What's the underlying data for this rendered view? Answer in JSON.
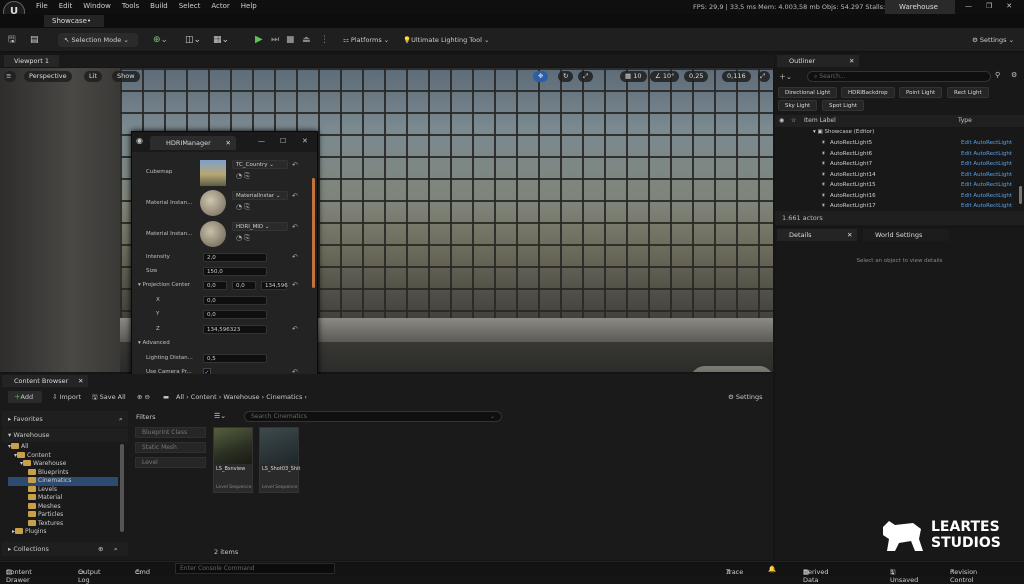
{
  "menubar": {
    "items": [
      "File",
      "Edit",
      "Window",
      "Tools",
      "Build",
      "Select",
      "Actor",
      "Help"
    ],
    "stats": "FPS: 29,9 | 33,5 ms   Mem: 4.003,58 mb   Objs: 54.297   Stalls: 0",
    "project": "Warehouse",
    "logo": "U"
  },
  "level_tab": "Showcase•",
  "toolbar": {
    "selection_mode": "Selection Mode",
    "platforms": "Platforms",
    "lighting_tool": "Ultimate Lighting Tool",
    "settings": "Settings"
  },
  "viewport": {
    "tab": "Viewport 1",
    "perspective": "Perspective",
    "lit": "Lit",
    "show": "Show",
    "grid_snap": "10",
    "rot_snap": "10°",
    "scale_snap": "0,25",
    "cam_speed": "0,116"
  },
  "hdri": {
    "title": "HDRIManager",
    "cubemap_label": "Cubemap",
    "cubemap_value": "TC_Country",
    "mat1_label": "Material Instan...",
    "mat1_value": "MaterialInstar",
    "mat2_label": "Material Instan...",
    "mat2_value": "HDRI_MID",
    "intensity_label": "Intensity",
    "intensity": "2,0",
    "size_label": "Size",
    "size": "150,0",
    "proj_label": "Projection Center",
    "proj_x": "0,0",
    "proj_y": "0,0",
    "proj_z": "134,596",
    "x_label": "X",
    "x": "0,0",
    "y_label": "Y",
    "y": "0,0",
    "z_label": "Z",
    "z": "134,596323",
    "advanced": "Advanced",
    "lighting_label": "Lighting Distan...",
    "lighting": "0,5",
    "camera_label": "Use Camera Pr..."
  },
  "outliner": {
    "tab": "Outliner",
    "search_placeholder": "Search...",
    "chips": [
      "Directional Light",
      "HDRIBackdrop",
      "Point Light",
      "Rect Light",
      "Sky Light",
      "Spot Light"
    ],
    "col_label": "Item Label",
    "col_type": "Type",
    "root": "Showcase (Editor)",
    "rows": [
      {
        "name": "AutoRectLight5",
        "type": "Edit AutoRectLight"
      },
      {
        "name": "AutoRectLight6",
        "type": "Edit AutoRectLight"
      },
      {
        "name": "AutoRectLight7",
        "type": "Edit AutoRectLight"
      },
      {
        "name": "AutoRectLight14",
        "type": "Edit AutoRectLight"
      },
      {
        "name": "AutoRectLight15",
        "type": "Edit AutoRectLight"
      },
      {
        "name": "AutoRectLight16",
        "type": "Edit AutoRectLight"
      },
      {
        "name": "AutoRectLight17",
        "type": "Edit AutoRectLight"
      }
    ],
    "count": "1.661 actors"
  },
  "details": {
    "tab": "Details",
    "world_tab": "World Settings",
    "empty": "Select an object to view details"
  },
  "content_browser": {
    "tab": "Content Browser",
    "add": "Add",
    "import": "Import",
    "save_all": "Save All",
    "path": [
      "All",
      "Content",
      "Warehouse",
      "Cinematics"
    ],
    "settings": "Settings",
    "favorites": "Favorites",
    "warehouse": "Warehouse",
    "tree": [
      "All",
      "Content",
      "Warehouse",
      "Blueprints",
      "Cinematics",
      "Levels",
      "Material",
      "Meshes",
      "Particles",
      "Textures",
      "Plugins"
    ],
    "filters_title": "Filters",
    "filters": [
      "Blueprint Class",
      "Static Mesh",
      "Level"
    ],
    "search_placeholder": "Search Cinematics",
    "assets": [
      {
        "name": "LS_Bsnview",
        "type": "Level Sequence"
      },
      {
        "name": "LS_Shot03_Shit",
        "type": "Level Sequence"
      }
    ],
    "count": "2 items",
    "collections": "Collections"
  },
  "status": {
    "drawer": "Content Drawer",
    "output": "Output Log",
    "cmd": "Cmd",
    "console_placeholder": "Enter Console Command",
    "trace": "Trace",
    "derived": "Derived Data",
    "unsaved": "1 Unsaved",
    "revision": "Revision Control"
  },
  "brand": {
    "line1": "LEARTES",
    "line2": "STUDIOS"
  }
}
